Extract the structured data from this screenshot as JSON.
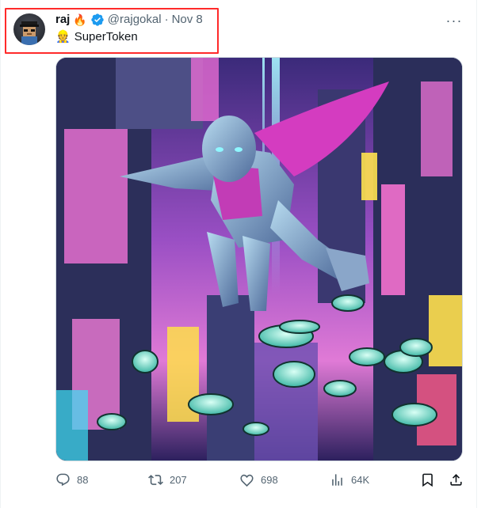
{
  "tweet": {
    "author_name": "raj",
    "author_emoji": "🔥",
    "handle": "@rajgokal",
    "separator": "·",
    "date": "Nov 8",
    "text_emoji": "👷",
    "text": "SuperToken",
    "more_label": "···"
  },
  "media": {
    "description_icon": "superhero-city-image"
  },
  "actions": {
    "reply_count": "88",
    "retweet_count": "207",
    "like_count": "698",
    "views_count": "64K"
  },
  "colors": {
    "verified": "#1d9bf0",
    "highlight_box": "#ff2a2a",
    "muted_text": "#536471"
  }
}
